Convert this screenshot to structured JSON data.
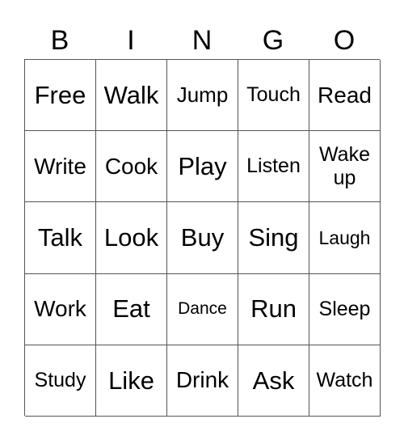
{
  "header": [
    "B",
    "I",
    "N",
    "G",
    "O"
  ],
  "cells": [
    [
      "Free",
      "Walk",
      "Jump",
      "Touch",
      "Read"
    ],
    [
      "Write",
      "Cook",
      "Play",
      "Listen",
      "Wake up"
    ],
    [
      "Talk",
      "Look",
      "Buy",
      "Sing",
      "Laugh"
    ],
    [
      "Work",
      "Eat",
      "Dance",
      "Run",
      "Sleep"
    ],
    [
      "Study",
      "Like",
      "Drink",
      "Ask",
      "Watch"
    ]
  ]
}
